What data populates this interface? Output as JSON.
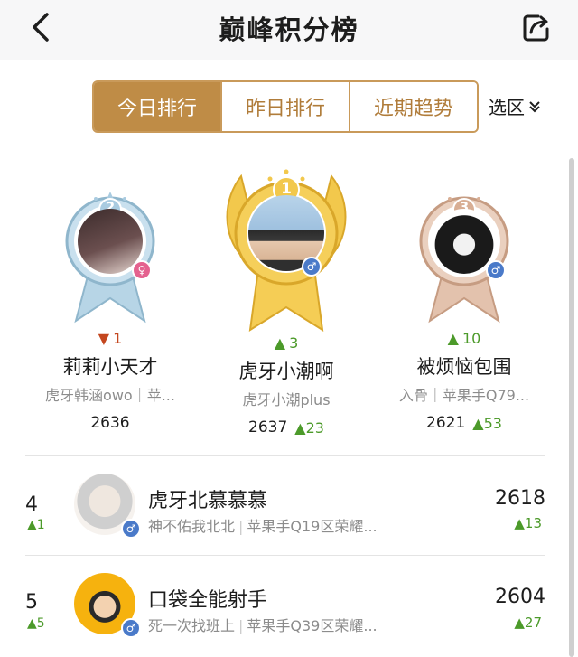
{
  "header": {
    "title": "巅峰积分榜",
    "back_icon": "back-arrow-icon",
    "share_icon": "share-icon"
  },
  "tabs": [
    {
      "label": "今日排行",
      "active": true
    },
    {
      "label": "昨日排行",
      "active": false
    },
    {
      "label": "近期趋势",
      "active": false
    }
  ],
  "region": {
    "label": "选区",
    "icon": "chevron-down-double-icon"
  },
  "podium": [
    {
      "rank": "2",
      "change_dir": "down",
      "change": "1",
      "name": "莉莉小天才",
      "sub": "虎牙韩涵owo｜苹...",
      "score": "2636",
      "delta": "",
      "gender": "female"
    },
    {
      "rank": "1",
      "change_dir": "up",
      "change": "3",
      "name": "虎牙小潮啊",
      "sub": "虎牙小潮plus",
      "score": "2637",
      "delta": "23",
      "gender": "male"
    },
    {
      "rank": "3",
      "change_dir": "up",
      "change": "10",
      "name": "被烦恼包围",
      "sub": "入骨｜苹果手Q79...",
      "score": "2621",
      "delta": "53",
      "gender": "male"
    }
  ],
  "list": [
    {
      "rank": "4",
      "delta_rank": "1",
      "name": "虎牙北慕慕慕",
      "team": "神不佑我北北",
      "server": "苹果手Q19区荣耀...",
      "score": "2618",
      "delta": "13"
    },
    {
      "rank": "5",
      "delta_rank": "5",
      "name": "口袋全能射手",
      "team": "死一次找班上",
      "server": "苹果手Q39区荣耀...",
      "score": "2604",
      "delta": "27"
    }
  ],
  "colors": {
    "accent": "#bf8c46",
    "gold": "#f0c24a",
    "silver": "#a9cbe0",
    "bronze": "#dcb49c",
    "up": "#4c9a2a",
    "down": "#c4471f"
  }
}
